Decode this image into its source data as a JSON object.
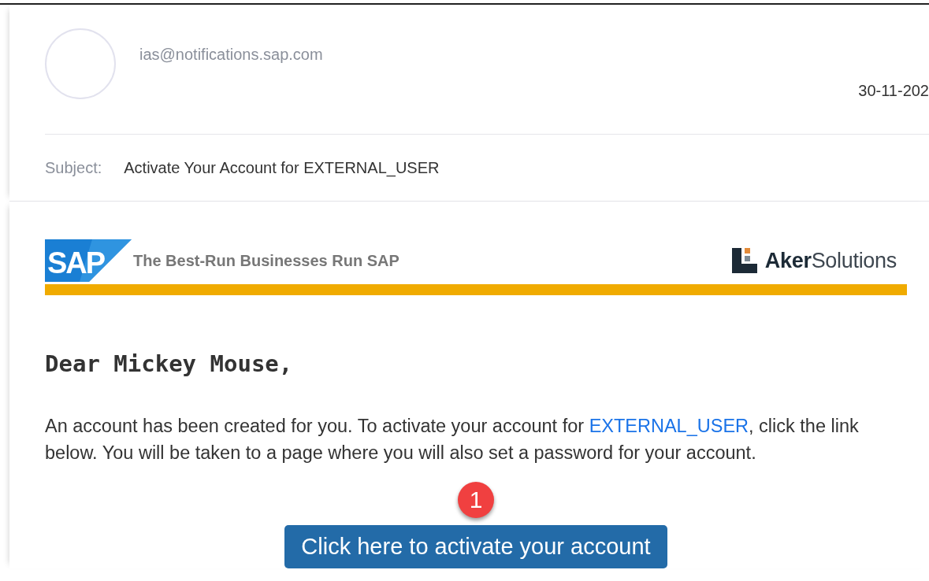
{
  "message": {
    "sender": "ias@notifications.sap.com",
    "date": "30-11-202",
    "subject_label": "Subject:",
    "subject": "Activate Your Account for EXTERNAL_USER"
  },
  "banner": {
    "sap_logo": "SAP",
    "tagline": "The Best-Run Businesses Run SAP",
    "partner_logo": "**Aker**Solutions"
  },
  "body": {
    "greeting": "Dear Mickey Mouse,",
    "paragraph": [
      "An account has been created for you. To activate your account for ",
      {
        "kind": "link",
        "text": "EXTERNAL_USER"
      },
      ", click the link below. You will be taken to a page where you will also set a password for your account."
    ],
    "step_badge": "1",
    "button": "Click here to activate your account"
  }
}
